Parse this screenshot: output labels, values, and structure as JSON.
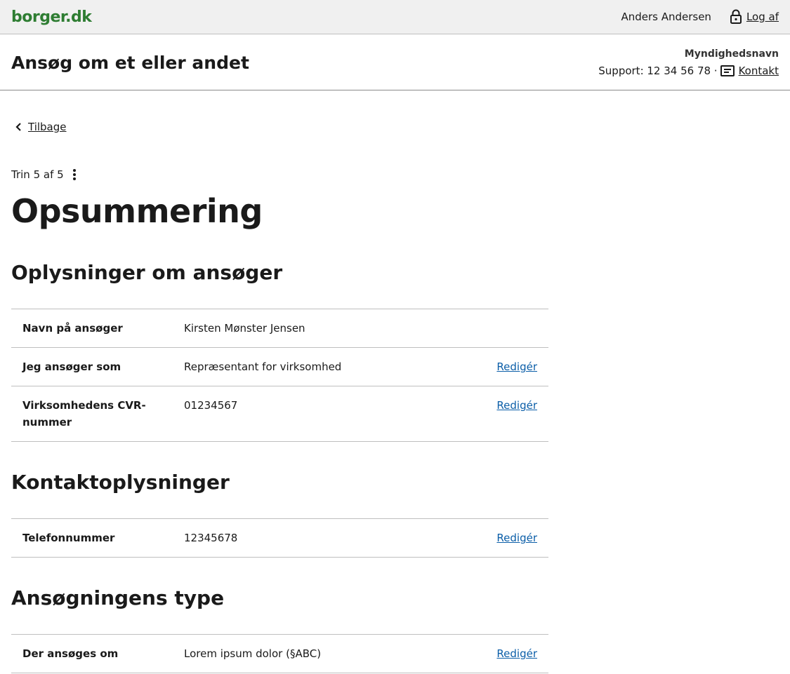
{
  "portal": {
    "logo": "borger.dk",
    "user_name": "Anders Andersen",
    "logout_label": "Log af"
  },
  "app_header": {
    "title": "Ansøg om et eller andet",
    "authority": "Myndighedsnavn",
    "support": "Support: 12 34 56 78 ·",
    "contact_label": "Kontakt"
  },
  "main": {
    "back_label": "Tilbage",
    "step": "Trin 5 af 5",
    "page_title": "Opsummering",
    "sections": [
      {
        "title": "Oplysninger om ansøger",
        "rows": [
          {
            "label": "Navn på ansøger",
            "value": "Kirsten Mønster Jensen",
            "action": ""
          },
          {
            "label": "Jeg ansøger som",
            "value": "Repræsentant for virksomhed",
            "action": "Redigér"
          },
          {
            "label": "Virksomhedens CVR-nummer",
            "value": "01234567",
            "action": "Redigér"
          }
        ]
      },
      {
        "title": "Kontaktoplysninger",
        "rows": [
          {
            "label": "Telefonnummer",
            "value": "12345678",
            "action": "Redigér"
          }
        ]
      },
      {
        "title": "Ansøgningens type",
        "rows": [
          {
            "label": "Der ansøges om",
            "value": "Lorem ipsum dolor (§ABC)",
            "action": "Redigér"
          }
        ]
      }
    ]
  },
  "icons": {
    "lock": "lock-icon",
    "contact": "message-icon",
    "back": "chevron-left-icon",
    "more": "more-vertical-icon"
  },
  "colors": {
    "logo": "#2e7d32",
    "link": "#0b5ea8",
    "portal_bar_bg": "#f0f0f0"
  }
}
